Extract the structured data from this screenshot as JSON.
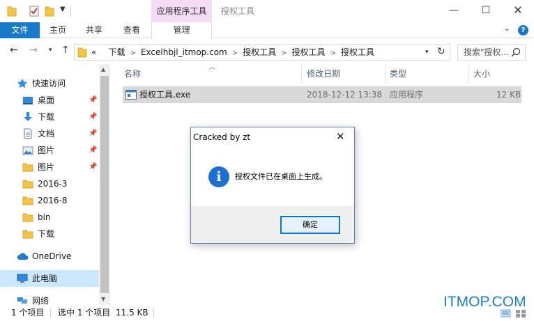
{
  "window": {
    "context_tab": "应用程序工具",
    "title": "授权工具",
    "minimize": "—",
    "maximize": "☐",
    "close": "✕"
  },
  "ribbon": {
    "file_tab": "文件",
    "tabs": [
      "主页",
      "共享",
      "查看"
    ],
    "manage_tab": "管理",
    "help": "?"
  },
  "address": {
    "overflow": "«",
    "path": [
      "下载",
      "Excelhbjl_itmop.com",
      "授权工具",
      "授权工具",
      "授权工具"
    ],
    "search_placeholder": "搜索\"授权..."
  },
  "nav": {
    "quick_access": "快速访问",
    "items": [
      {
        "label": "桌面",
        "pinned": true
      },
      {
        "label": "下载",
        "pinned": true
      },
      {
        "label": "文档",
        "pinned": true
      },
      {
        "label": "图片",
        "pinned": true
      },
      {
        "label": "图片",
        "pinned": true
      },
      {
        "label": "2016-3",
        "pinned": false
      },
      {
        "label": "2016-8",
        "pinned": false
      },
      {
        "label": "bin",
        "pinned": false
      },
      {
        "label": "下载",
        "pinned": false
      }
    ],
    "onedrive": "OneDrive",
    "this_pc": "此电脑",
    "network": "网络"
  },
  "files": {
    "columns": {
      "name": "名称",
      "date": "修改日期",
      "type": "类型",
      "size": "大小"
    },
    "rows": [
      {
        "name": "授权工具.exe",
        "date": "2018-12-12 13:38",
        "type": "应用程序",
        "size": "12 KB"
      }
    ]
  },
  "status": {
    "items": "1 个项目",
    "selected": "选中 1 个项目",
    "size": "11.5 KB"
  },
  "watermark": "ITMOP.COM",
  "dialog": {
    "title": "Cracked by zt",
    "close": "✕",
    "icon": "i",
    "message": "授权文件已在桌面上生成。",
    "ok": "确定"
  },
  "colors": {
    "accent": "#1979ca",
    "context_tab": "#f4dcf6",
    "selection": "#cce8ff",
    "dialog_border": "#4f84c8"
  }
}
